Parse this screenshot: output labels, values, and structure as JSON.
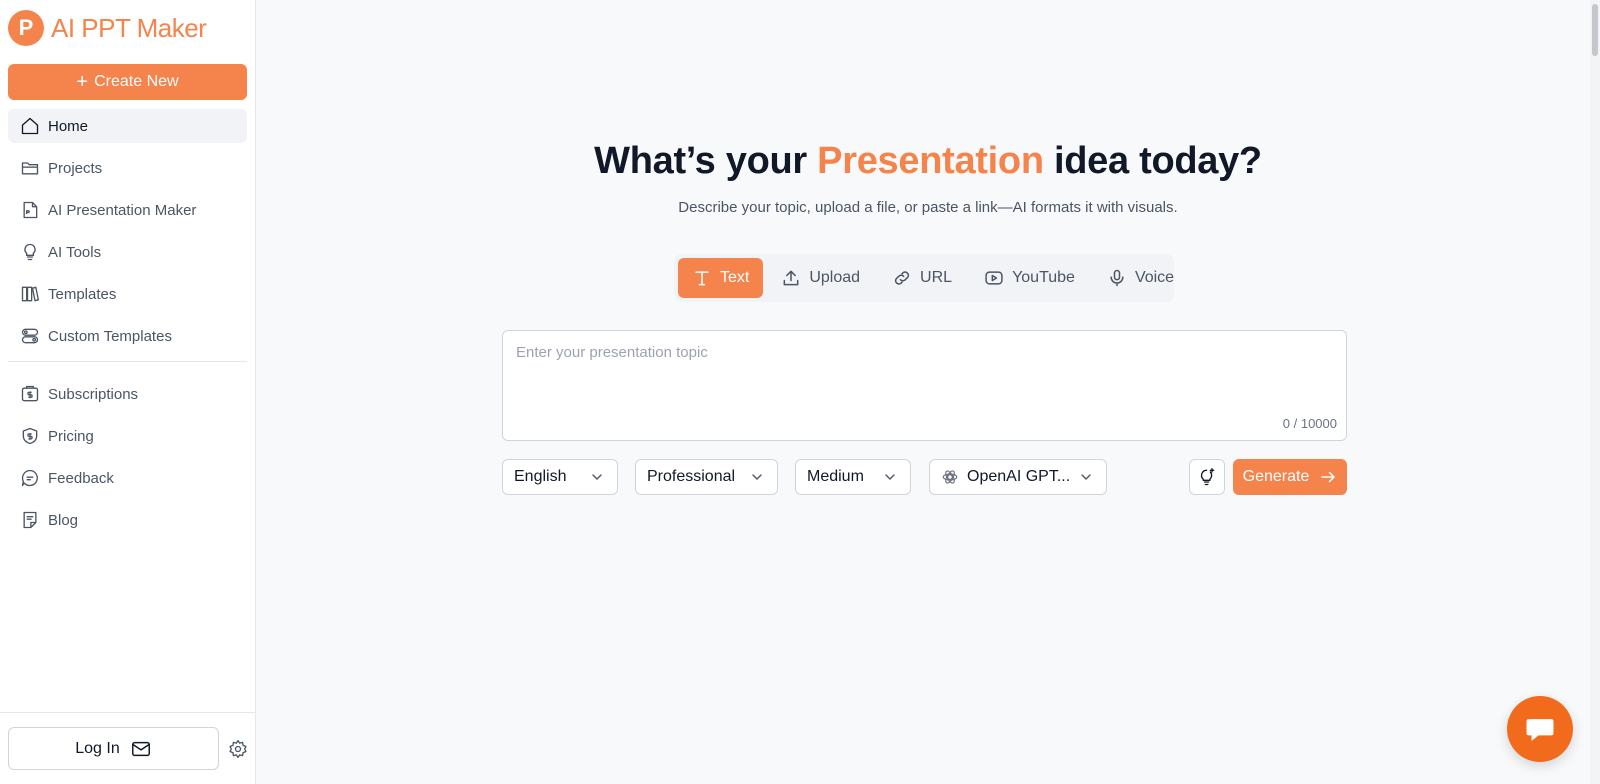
{
  "brand": {
    "logo_letter": "P",
    "name": "AI PPT Maker"
  },
  "sidebar": {
    "create_label": "Create New",
    "items": [
      {
        "label": "Home",
        "icon": "home-icon",
        "active": true
      },
      {
        "label": "Projects",
        "icon": "folder-icon"
      },
      {
        "label": "AI Presentation Maker",
        "icon": "ppt-file-icon"
      },
      {
        "label": "AI Tools",
        "icon": "lightbulb-gear-icon"
      },
      {
        "label": "Templates",
        "icon": "books-icon"
      },
      {
        "label": "Custom Templates",
        "icon": "toggles-icon"
      }
    ],
    "items2": [
      {
        "label": "Subscriptions",
        "icon": "wallet-dollar-icon"
      },
      {
        "label": "Pricing",
        "icon": "shield-dollar-icon"
      },
      {
        "label": "Feedback",
        "icon": "chat-bubble-icon"
      },
      {
        "label": "Blog",
        "icon": "sticky-note-icon"
      }
    ],
    "login_label": "Log In"
  },
  "main": {
    "title_before": "What’s your ",
    "title_accent": "Presentation",
    "title_after": " idea today?",
    "subtitle": "Describe your topic, upload a file, or paste a link—AI formats it with visuals.",
    "tabs": [
      {
        "label": "Text",
        "active": true
      },
      {
        "label": "Upload"
      },
      {
        "label": "URL"
      },
      {
        "label": "YouTube"
      },
      {
        "label": "Voice"
      }
    ],
    "topic_placeholder": "Enter your presentation topic",
    "topic_value": "",
    "char_counter": "0 / 10000",
    "selects": {
      "language": "English",
      "tone": "Professional",
      "length": "Medium",
      "model": "OpenAI GPT..."
    },
    "generate_label": "Generate"
  },
  "colors": {
    "accent": "#f5844c",
    "fab": "#f26b1d"
  }
}
